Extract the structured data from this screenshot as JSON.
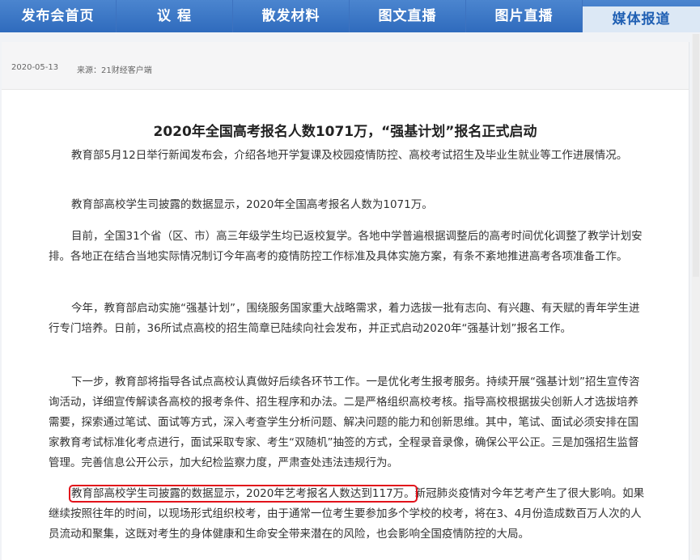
{
  "nav": {
    "items": [
      {
        "label": "发布会首页"
      },
      {
        "label": "议  程"
      },
      {
        "label": "散发材料"
      },
      {
        "label": "图文直播"
      },
      {
        "label": "图片直播"
      },
      {
        "label": "媒体报道"
      }
    ]
  },
  "meta": {
    "date": "2020-05-13",
    "source": "来源：21财经客户端"
  },
  "article": {
    "title": "2020年全国高考报名人数1071万，“强基计划”报名正式启动",
    "p1": "教育部5月12日举行新闻发布会，介绍各地开学复课及校园疫情防控、高校考试招生及毕业生就业等工作进展情况。",
    "p2": "教育部高校学生司披露的数据显示，2020年全国高考报名人数为1071万。",
    "p3": "目前，全国31个省（区、市）高三年级学生均已返校复学。各地中学普遍根据调整后的高考时间优化调整了教学计划安排。各地正在结合当地实际情况制订今年高考的疫情防控工作标准及具体实施方案，有条不紊地推进高考各项准备工作。",
    "p4": "今年，教育部启动实施“强基计划”，围绕服务国家重大战略需求，着力选拔一批有志向、有兴趣、有天赋的青年学生进行专门培养。日前，36所试点高校的招生简章已陆续向社会发布，并正式启动2020年“强基计划”报名工作。",
    "p5": "下一步，教育部将指导各试点高校认真做好后续各环节工作。一是优化考生报考服务。持续开展“强基计划”招生宣传咨询活动，详细宣传解读各高校的报考条件、招生程序和办法。二是严格组织高校考核。指导高校根据拔尖创新人才选拔培养需要，探索通过笔试、面试等方式，深入考查学生分析问题、解决问题的能力和创新思维。其中，笔试、面试必须安排在国家教育考试标准化考点进行，面试采取专家、考生“双随机”抽签的方式，全程录音录像，确保公平公正。三是加强招生监督管理。完善信息公开公示，加大纪检监察力度，严肃查处违法违规行为。",
    "p6_highlight": "教育部高校学生司披露的数据显示，2020年艺考报名人数达到117万。",
    "p6_rest": "新冠肺炎疫情对今年艺考产生了很大影响。如果继续按照往年的时间，以现场形式组织校考，由于通常一位考生要参加多个学校的校考，将在3、4月份造成数百万人次的人员流动和聚集，这既对考生的身体健康和生命安全带来潜在的风险，也会影响全国疫情防控的大局。"
  }
}
